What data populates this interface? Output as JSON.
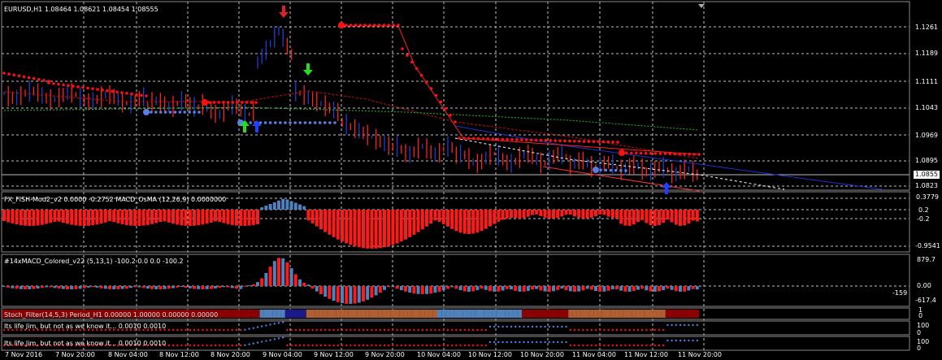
{
  "main": {
    "title": "EURUSD,H1  1.08464 1.08621 1.08454 1.08555",
    "price_labels": [
      "1.1261",
      "1.1189",
      "1.1111",
      "1.1043",
      "1.0969",
      "1.0895",
      "1.0823"
    ],
    "current_price": "1.0855"
  },
  "panels": [
    {
      "title": "FX_FISH-Mod2_v2 0.0000 -0.2752  MACD_OsMA (12,26,9) 0.0000000",
      "scale": [
        "0.3779",
        "0.2",
        "-0.2",
        "-0.9541"
      ]
    },
    {
      "title": "#14xMACD_Colored_v22 (5,13,1) -100.2 0.0 0.0 -100.2",
      "scale": [
        "879.7",
        "0.00",
        "-617.4"
      ],
      "value_tag": "-159"
    },
    {
      "title": "Stoch_Filter(14,5,3) Period_H1 0.00000 1.00000 0.00000 0.00000",
      "scale": [
        "1",
        "0"
      ]
    },
    {
      "title": "Its life Jim, but not as we know it...  0.0010 0.0010",
      "scale": [
        "100",
        "0"
      ]
    },
    {
      "title": "Its life Jim, but not as we know it...  0.0010 0.0010",
      "scale": [
        "100",
        "0"
      ]
    }
  ],
  "time_axis": [
    "7 Nov 2016",
    "7 Nov 20:00",
    "8 Nov 04:00",
    "8 Nov 12:00",
    "8 Nov 20:00",
    "9 Nov 04:00",
    "9 Nov 12:00",
    "9 Nov 20:00",
    "10 Nov 04:00",
    "10 Nov 12:00",
    "10 Nov 20:00",
    "11 Nov 04:00",
    "11 Nov 12:00",
    "11 Nov 20:00"
  ],
  "colors": {
    "bg": "#000000",
    "grid": "#c0c0c0",
    "bull": "#1f3fd0",
    "bear": "#ff2020",
    "dots_red": "#ff1010",
    "dots_blue": "#5a7fe0",
    "green_arrow": "#20e020",
    "stoch_blue": "#4f81bd",
    "stoch_brown": "#b06030",
    "stoch_dark": "#8b0000"
  },
  "chart_data": {
    "type": "candlestick",
    "title": "EURUSD,H1",
    "ohlc_last": {
      "open": 1.08464,
      "high": 1.08621,
      "low": 1.08454,
      "close": 1.08555
    },
    "ylim": [
      1.0823,
      1.1261
    ],
    "y_ticks": [
      1.1261,
      1.1189,
      1.1111,
      1.1043,
      1.0969,
      1.0895,
      1.0823
    ]
  }
}
